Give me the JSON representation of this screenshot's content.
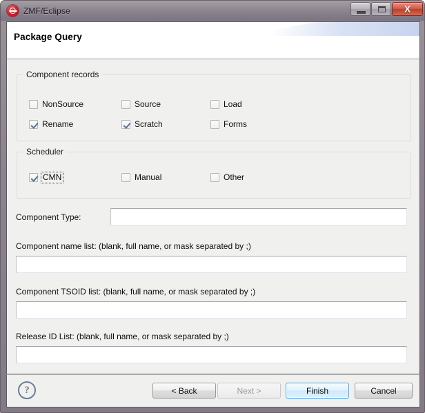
{
  "window": {
    "title": "ZMF/Eclipse",
    "app_icon": "zmf-logo-icon",
    "controls": {
      "minimize": "–",
      "maximize": "□",
      "close": "X"
    }
  },
  "header": {
    "title": "Package Query"
  },
  "groups": [
    {
      "id": "component-records",
      "title": "Component records",
      "checkboxes": [
        {
          "label": "NonSource",
          "checked": false,
          "focused": false
        },
        {
          "label": "Source",
          "checked": false,
          "focused": false
        },
        {
          "label": "Load",
          "checked": false,
          "focused": false
        },
        {
          "label": "Rename",
          "checked": true,
          "focused": false
        },
        {
          "label": "Scratch",
          "checked": true,
          "focused": false
        },
        {
          "label": "Forms",
          "checked": false,
          "focused": false
        }
      ]
    },
    {
      "id": "scheduler",
      "title": "Scheduler",
      "checkboxes": [
        {
          "label": "CMN",
          "checked": true,
          "focused": true
        },
        {
          "label": "Manual",
          "checked": false,
          "focused": false
        },
        {
          "label": "Other",
          "checked": false,
          "focused": false
        }
      ]
    }
  ],
  "fields": [
    {
      "id": "component-type",
      "label": "Component Type:",
      "value": "",
      "placeholder": ""
    },
    {
      "id": "component-name-list",
      "label": "Component name list:  (blank, full name, or mask separated by ;)",
      "value": "",
      "placeholder": ""
    },
    {
      "id": "component-tsoid-list",
      "label": "Component TSOID list:  (blank, full name, or mask separated by ;)",
      "value": "",
      "placeholder": ""
    },
    {
      "id": "release-id-list",
      "label": "Release ID List:  (blank, full name, or mask separated by ;)",
      "value": "",
      "placeholder": ""
    }
  ],
  "buttonbar": {
    "help_glyph": "?",
    "buttons": [
      {
        "id": "back",
        "label": "< Back",
        "mnemonic": "B",
        "state": "enabled",
        "default": false
      },
      {
        "id": "next",
        "label": "Next >",
        "mnemonic": "N",
        "state": "disabled",
        "default": false
      },
      {
        "id": "finish",
        "label": "Finish",
        "mnemonic": "",
        "state": "enabled",
        "default": true
      },
      {
        "id": "cancel",
        "label": "Cancel",
        "mnemonic": "",
        "state": "enabled",
        "default": false
      }
    ]
  },
  "colors": {
    "titlebar": "#8b8490",
    "body": "#f0f0ef",
    "default_button_border": "#3c9de0",
    "check_mark": "#5b7192",
    "close_button": "#c44a33"
  }
}
